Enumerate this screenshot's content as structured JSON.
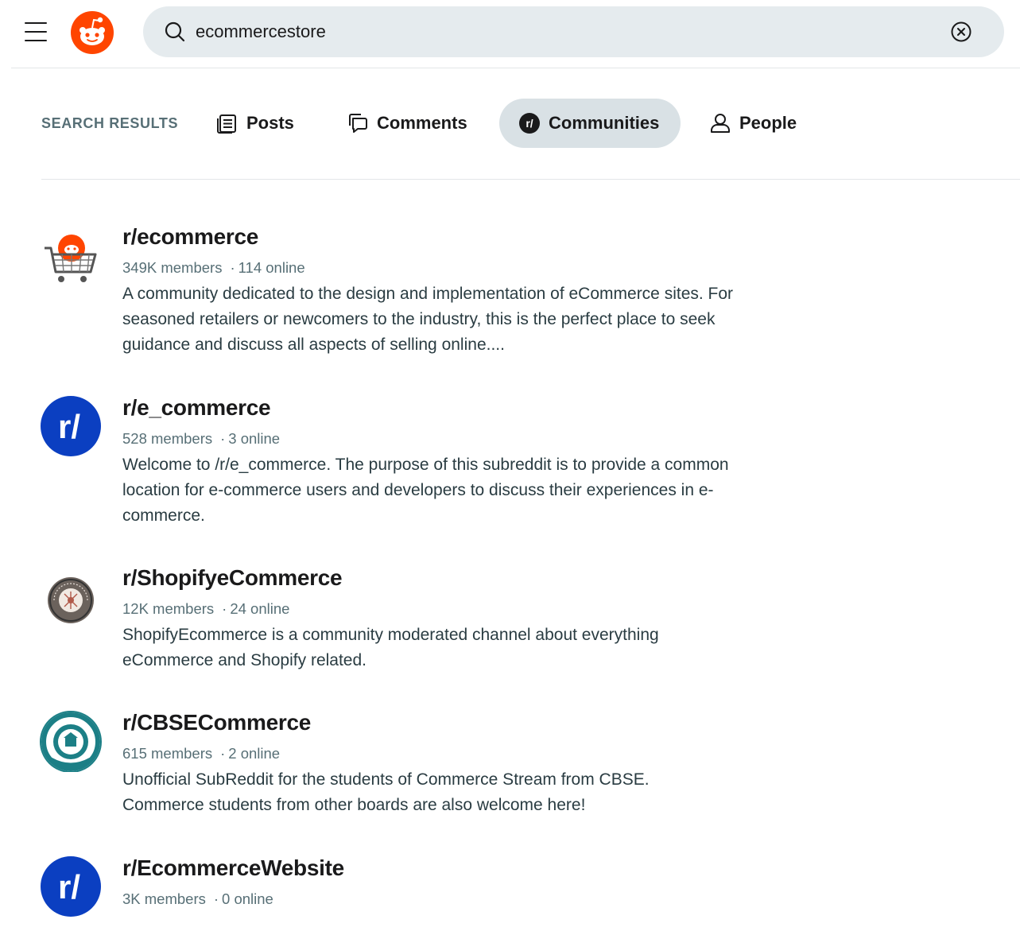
{
  "search": {
    "query": "ecommercestore"
  },
  "tabs": {
    "results_label": "SEARCH RESULTS",
    "posts": "Posts",
    "comments": "Comments",
    "communities": "Communities",
    "people": "People",
    "active": "Communities"
  },
  "results": [
    {
      "name": "r/ecommerce",
      "members": "349K members",
      "online": "114 online",
      "description": "A community dedicated to the design and implementation of eCommerce sites. For seasoned retailers or newcomers to the industry, this is the perfect place to seek guidance and discuss all aspects of selling online....",
      "avatar": "cart-snoo-icon"
    },
    {
      "name": "r/e_commerce",
      "members": "528 members",
      "online": "3 online",
      "description": "Welcome to /r/e_commerce. The purpose of this subreddit is to provide a common location for e-commerce users and developers to discuss their experiences in e-commerce.",
      "avatar": "default-community-icon"
    },
    {
      "name": "r/ShopifyeCommerce",
      "members": "12K members",
      "online": "24 online",
      "description": "ShopifyEcommerce is a community moderated channel about everything eCommerce and Shopify related.",
      "avatar": "shopify-seal-icon"
    },
    {
      "name": "r/CBSECommerce",
      "members": "615 members",
      "online": "2 online",
      "description": "Unofficial SubReddit for the students of Commerce Stream from CBSE. Commerce students from other boards are also welcome here!",
      "avatar": "cbse-seal-icon"
    },
    {
      "name": "r/EcommerceWebsite",
      "members": "3K members",
      "online": "0 online",
      "description": "",
      "avatar": "default-community-icon"
    }
  ],
  "colors": {
    "brand": "#ff4500",
    "default_avatar": "#0b3fc1",
    "active_tab_bg": "#d9e1e5",
    "search_bg": "#e5ebee",
    "meta_text": "#576f76"
  }
}
